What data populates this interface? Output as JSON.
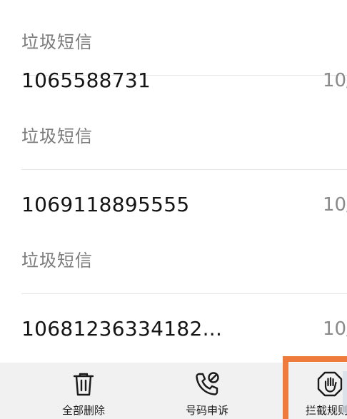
{
  "messages": [
    {
      "number": "",
      "date": "",
      "category": "垃圾短信"
    },
    {
      "number": "1065588731",
      "date": "10/",
      "category": "垃圾短信"
    },
    {
      "number": "1069118895555",
      "date": "10/",
      "category": "垃圾短信"
    },
    {
      "number": "10681236334182...",
      "date": "10/",
      "category": ""
    }
  ],
  "toolbar": {
    "delete_all_label": "全部删除",
    "appeal_label": "号码申诉",
    "rules_label": "拦截规则"
  },
  "colors": {
    "highlight": "#ee7a3c",
    "toolbar_bg": "#f1f1f1",
    "divider": "#e6e6e6"
  },
  "icons": {
    "delete": "trash-icon",
    "appeal": "phone-blocked-icon",
    "rules": "hand-stop-icon"
  }
}
